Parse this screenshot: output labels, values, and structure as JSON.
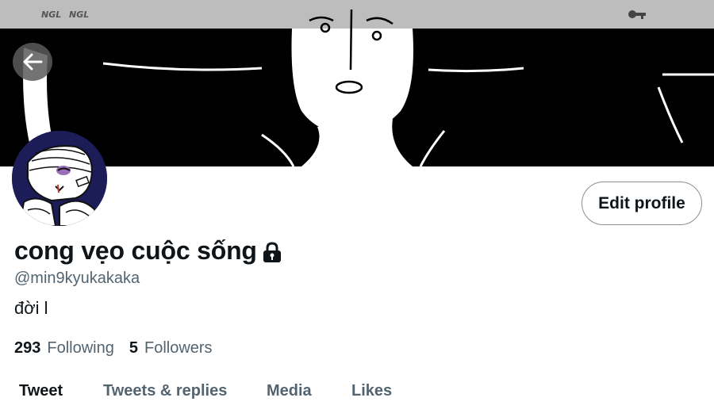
{
  "banner": {
    "watermark_left_1": "NGL",
    "watermark_left_2": "NGL"
  },
  "profile": {
    "display_name": "cong vẹo cuộc sống",
    "handle": "@min9kyukakaka",
    "bio": "đời l",
    "locked": true,
    "edit_button_label": "Edit profile"
  },
  "stats": {
    "following_count": "293",
    "following_label": "Following",
    "followers_count": "5",
    "followers_label": "Followers"
  },
  "tabs": [
    {
      "label": "Tweet",
      "active": true
    },
    {
      "label": "Tweets & replies",
      "active": false
    },
    {
      "label": "Media",
      "active": false
    },
    {
      "label": "Likes",
      "active": false
    }
  ],
  "colors": {
    "text_primary": "#0f1419",
    "text_secondary": "#536471",
    "avatar_bg": "#1c1c58"
  }
}
